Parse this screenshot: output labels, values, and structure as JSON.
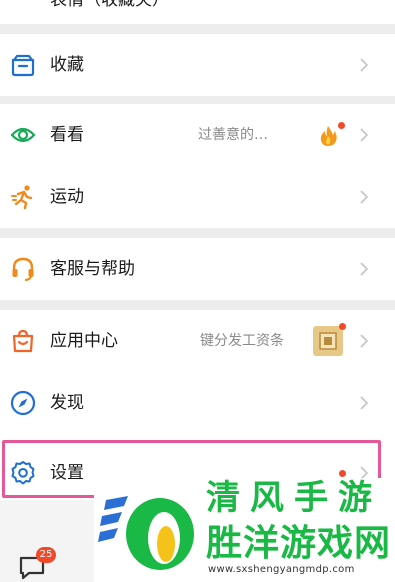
{
  "rows": {
    "partial_top": {
      "label": "表情（收藏夹）"
    },
    "favorites": {
      "label": "收藏"
    },
    "kankan": {
      "label": "看看",
      "subtitle": "过善意的…"
    },
    "sports": {
      "label": "运动"
    },
    "support": {
      "label": "客服与帮助"
    },
    "appcenter": {
      "label": "应用中心",
      "subtitle": "键分发工资条"
    },
    "discover": {
      "label": "发现"
    },
    "settings": {
      "label": "设置"
    }
  },
  "bottom_nav": {
    "message_badge": "25"
  },
  "watermark": {
    "top_text": "清风手游",
    "brand": "胜洋游戏网",
    "url": "www.sxshengyangmdp.com"
  },
  "colors": {
    "icon_blue": "#1f6fd1",
    "icon_orange": "#f08a1c",
    "icon_green": "#18a957",
    "badge_red": "#f04a2a",
    "highlight_pink": "#e4589a",
    "watermark_green": "#1ab845"
  }
}
